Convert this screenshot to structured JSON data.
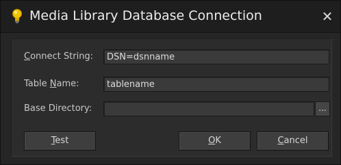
{
  "window": {
    "title": "Media Library Database Connection",
    "close_glyph": "✕",
    "icon": "lightbulb-icon"
  },
  "form": {
    "connect_string": {
      "label_mnemonic": "C",
      "label_rest": "onnect String:",
      "value": "DSN=dsnname"
    },
    "table_name": {
      "label_before": "Table ",
      "label_mnemonic": "N",
      "label_rest": "ame:",
      "value": "tablename"
    },
    "base_directory": {
      "label": "Base Directory:",
      "value": "",
      "browse_label": "..."
    }
  },
  "buttons": {
    "test": {
      "mnemonic": "T",
      "rest": "est"
    },
    "ok": {
      "mnemonic": "O",
      "rest": "K"
    },
    "cancel": {
      "mnemonic": "C",
      "rest": "ancel"
    }
  },
  "colors": {
    "background": "#262626",
    "titlebar": "#1e1e1e",
    "field": "#3a3a3a",
    "text": "#c8c8c8",
    "icon_yellow": "#f2c200"
  }
}
